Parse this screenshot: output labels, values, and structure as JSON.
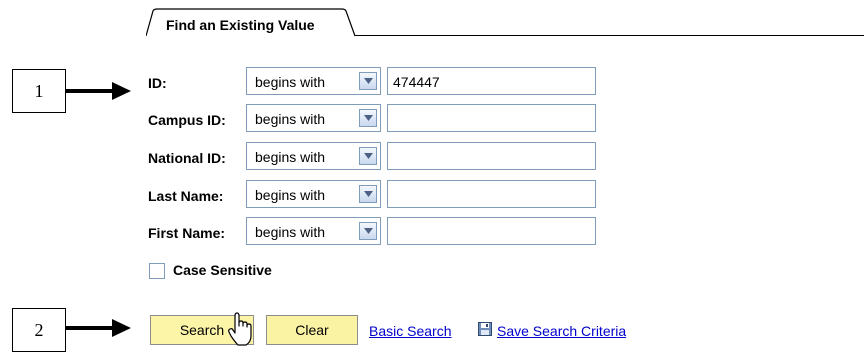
{
  "tab": {
    "label": "Find an Existing Value"
  },
  "fields": [
    {
      "label": "ID:",
      "operator": "begins with",
      "value": "474447"
    },
    {
      "label": "Campus ID:",
      "operator": "begins with",
      "value": ""
    },
    {
      "label": "National ID:",
      "operator": "begins with",
      "value": ""
    },
    {
      "label": "Last Name:",
      "operator": "begins with",
      "value": ""
    },
    {
      "label": "First Name:",
      "operator": "begins with",
      "value": ""
    }
  ],
  "case_sensitive": {
    "label": "Case Sensitive",
    "checked": false
  },
  "buttons": {
    "search": "Search",
    "clear": "Clear"
  },
  "links": {
    "basic_search": "Basic Search",
    "save_search": "Save Search Criteria"
  },
  "callouts": {
    "one": "1",
    "two": "2"
  }
}
